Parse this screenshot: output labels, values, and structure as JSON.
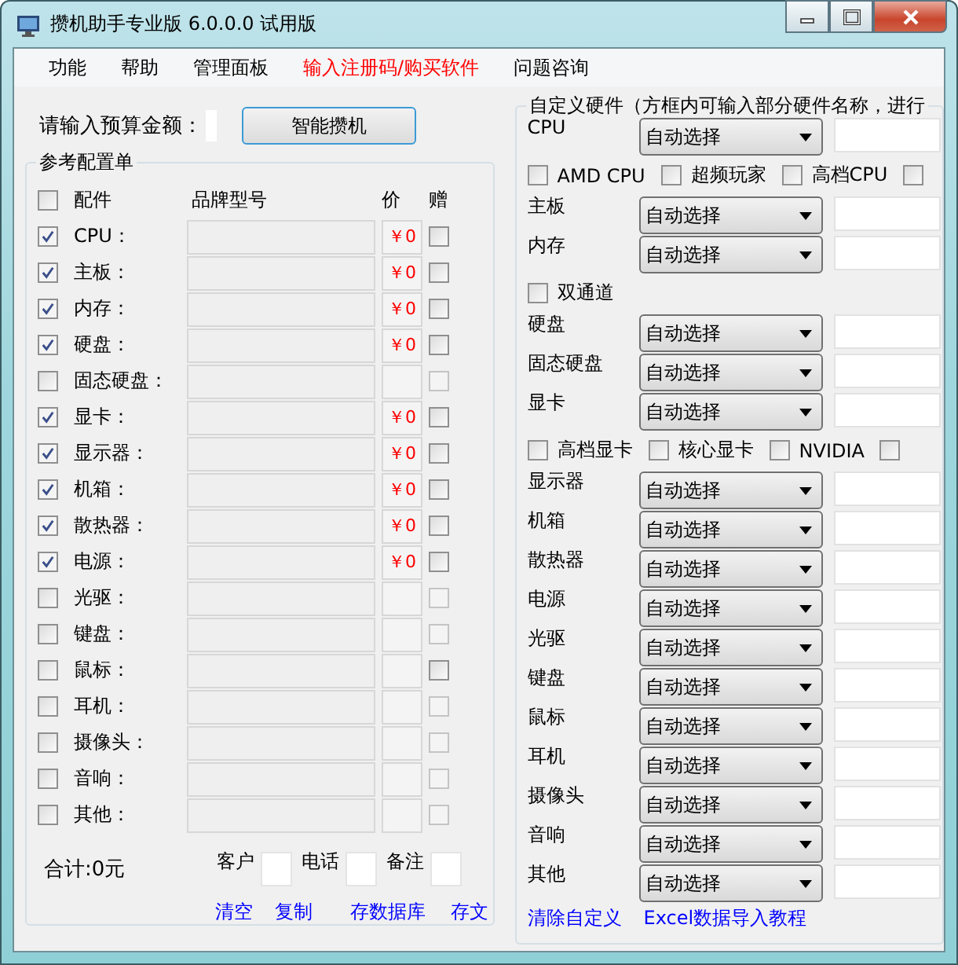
{
  "window": {
    "title": "攒机助手专业版 6.0.0.0 试用版"
  },
  "menu": [
    {
      "label": "功能",
      "color": "#000000"
    },
    {
      "label": "帮助",
      "color": "#000000"
    },
    {
      "label": "管理面板",
      "color": "#000000"
    },
    {
      "label": "输入注册码/购买软件",
      "color": "#ff0000"
    },
    {
      "label": "问题咨询",
      "color": "#000000"
    }
  ],
  "budget": {
    "label": "请输入预算金额：",
    "button": "智能攒机"
  },
  "config": {
    "title": "参考配置单",
    "header": {
      "checked": false,
      "part": "配件",
      "brand": "品牌型号",
      "price": "价",
      "gift": "赠"
    },
    "rows": [
      {
        "label": "CPU：",
        "checked": true,
        "price": "￥0",
        "gift_disabled": false
      },
      {
        "label": "主板：",
        "checked": true,
        "price": "￥0",
        "gift_disabled": false
      },
      {
        "label": "内存：",
        "checked": true,
        "price": "￥0",
        "gift_disabled": false
      },
      {
        "label": "硬盘：",
        "checked": true,
        "price": "￥0",
        "gift_disabled": false
      },
      {
        "label": "固态硬盘：",
        "checked": false,
        "gift_disabled": true
      },
      {
        "label": "显卡：",
        "checked": true,
        "price": "￥0",
        "gift_disabled": false
      },
      {
        "label": "显示器：",
        "checked": true,
        "price": "￥0",
        "gift_disabled": false
      },
      {
        "label": "机箱：",
        "checked": true,
        "price": "￥0",
        "gift_disabled": false
      },
      {
        "label": "散热器：",
        "checked": true,
        "price": "￥0",
        "gift_disabled": false
      },
      {
        "label": "电源：",
        "checked": true,
        "price": "￥0",
        "gift_disabled": false
      },
      {
        "label": "光驱：",
        "checked": false,
        "gift_disabled": true
      },
      {
        "label": "键盘：",
        "checked": false,
        "gift_disabled": true
      },
      {
        "label": "鼠标：",
        "checked": false,
        "gift_disabled": false
      },
      {
        "label": "耳机：",
        "checked": false,
        "gift_disabled": true
      },
      {
        "label": "摄像头：",
        "checked": false,
        "gift_disabled": true
      },
      {
        "label": "音响：",
        "checked": false,
        "gift_disabled": true
      },
      {
        "label": "其他：",
        "checked": false,
        "gift_disabled": true
      }
    ],
    "total": "合计:0元",
    "fields": [
      {
        "label": "客户"
      },
      {
        "label": "电话"
      },
      {
        "label": "备注"
      }
    ],
    "links": [
      "清空",
      "复制",
      "存数据库",
      "存文"
    ]
  },
  "custom": {
    "title": "自定义硬件（方框内可输入部分硬件名称，进行",
    "rows": [
      {
        "kind": "select",
        "label": "CPU",
        "value": "自动选择"
      },
      {
        "kind": "options",
        "items": [
          {
            "label": "AMD CPU",
            "checked": false
          },
          {
            "label": "超频玩家",
            "checked": false
          },
          {
            "label": "高档CPU",
            "checked": false
          },
          {
            "checked": false
          }
        ]
      },
      {
        "kind": "select",
        "label": "主板",
        "value": "自动选择"
      },
      {
        "kind": "select",
        "label": "内存",
        "value": "自动选择"
      },
      {
        "kind": "options",
        "items": [
          {
            "label": "双通道",
            "checked": false
          }
        ]
      },
      {
        "kind": "select",
        "label": "硬盘",
        "value": "自动选择"
      },
      {
        "kind": "select",
        "label": "固态硬盘",
        "value": "自动选择"
      },
      {
        "kind": "select",
        "label": "显卡",
        "value": "自动选择"
      },
      {
        "kind": "options",
        "items": [
          {
            "label": "高档显卡",
            "checked": false
          },
          {
            "label": "核心显卡",
            "checked": false
          },
          {
            "label": "NVIDIA",
            "checked": false
          },
          {
            "checked": false
          }
        ]
      },
      {
        "kind": "select",
        "label": "显示器",
        "value": "自动选择"
      },
      {
        "kind": "select",
        "label": "机箱",
        "value": "自动选择"
      },
      {
        "kind": "select",
        "label": "散热器",
        "value": "自动选择"
      },
      {
        "kind": "select",
        "label": "电源",
        "value": "自动选择"
      },
      {
        "kind": "select",
        "label": "光驱",
        "value": "自动选择"
      },
      {
        "kind": "select",
        "label": "键盘",
        "value": "自动选择"
      },
      {
        "kind": "select",
        "label": "鼠标",
        "value": "自动选择"
      },
      {
        "kind": "select",
        "label": "耳机",
        "value": "自动选择"
      },
      {
        "kind": "select",
        "label": "摄像头",
        "value": "自动选择"
      },
      {
        "kind": "select",
        "label": "音响",
        "value": "自动选择"
      },
      {
        "kind": "select",
        "label": "其他",
        "value": "自动选择"
      }
    ],
    "links": [
      "清除自定义",
      "Excel数据导入教程"
    ]
  }
}
